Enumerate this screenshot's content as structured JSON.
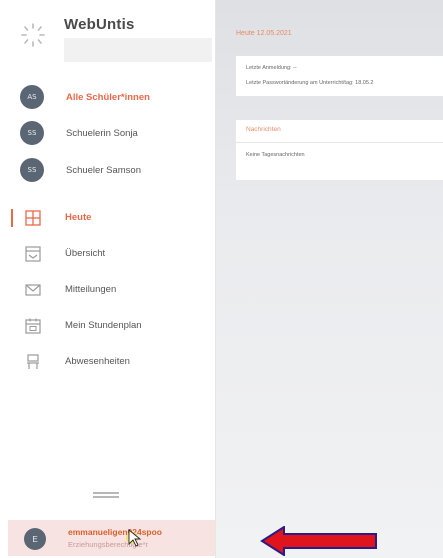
{
  "app": {
    "title": "WebUntis"
  },
  "sidebar": {
    "people": [
      {
        "label": "Alle Schüler*innen",
        "initials": "AS",
        "active": true
      },
      {
        "label": "Schuelerin Sonja",
        "initials": "SS",
        "active": false
      },
      {
        "label": "Schueler Samson",
        "initials": "SS",
        "active": false
      }
    ],
    "nav": [
      {
        "label": "Heute",
        "icon": "home-grid-icon",
        "active": true
      },
      {
        "label": "Übersicht",
        "icon": "overview-icon",
        "active": false
      },
      {
        "label": "Mitteilungen",
        "icon": "mail-icon",
        "active": false
      },
      {
        "label": "Mein Stundenplan",
        "icon": "calendar-icon",
        "active": false
      },
      {
        "label": "Abwesenheiten",
        "icon": "absence-icon",
        "active": false
      }
    ],
    "user": {
      "name": "emmanueligen024spoo",
      "role": "Erziehungsberechtigte*r",
      "initials": "E"
    }
  },
  "main": {
    "today_label": "Heute 12.05.2021",
    "card1": {
      "line1": "Letzte Anmeldung: --",
      "line2": "Letzte Passwortänderung am Unterricht/tag: 18.05.2"
    },
    "card2": {
      "header": "Nachrichten",
      "text": "Keine Tagesnachrichten"
    }
  },
  "colors": {
    "accent": "#e8694a",
    "avatar": "#5b6674",
    "footer_bg": "#f8e3e3",
    "arrow": "#e0141c"
  }
}
